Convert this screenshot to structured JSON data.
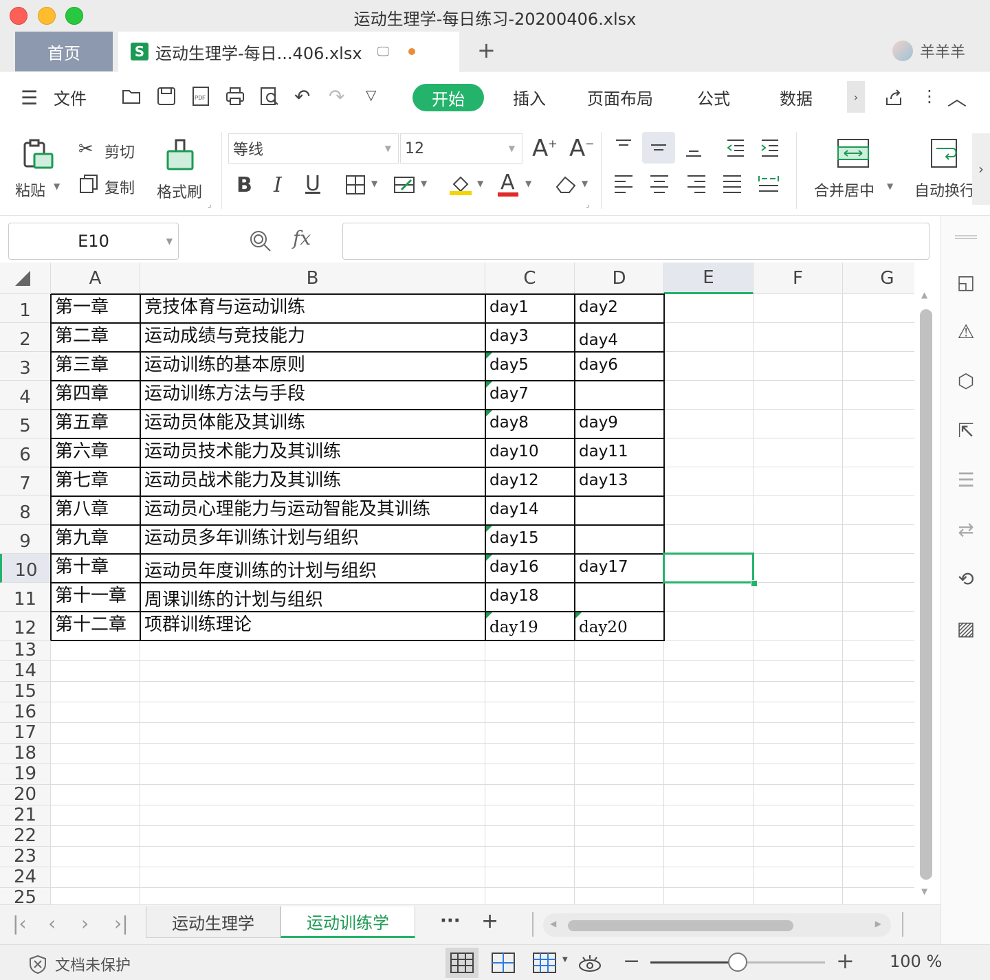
{
  "window": {
    "title": "运动生理学-每日练习-20200406.xlsx"
  },
  "tabs": {
    "home": "首页",
    "file_tab": "运动生理学-每日...406.xlsx",
    "add": "+"
  },
  "user": {
    "name": "羊羊羊"
  },
  "menu": {
    "file": "文件",
    "items": [
      "开始",
      "插入",
      "页面布局",
      "公式",
      "数据"
    ]
  },
  "toolbar": {
    "paste": "粘贴",
    "cut": "剪切",
    "copy": "复制",
    "format_painter": "格式刷",
    "font_name": "等线",
    "font_size": "12",
    "merge_center": "合并居中",
    "wrap_text": "自动换行"
  },
  "formula_bar": {
    "name_box": "E10",
    "fx": "fx",
    "content": ""
  },
  "sheet": {
    "columns": [
      "A",
      "B",
      "C",
      "D",
      "E",
      "F",
      "G"
    ],
    "active_column": "E",
    "active_row": 10,
    "rows": [
      {
        "n": "1",
        "a": "第一章",
        "b": "竞技体育与运动训练",
        "c": "day1",
        "d": "day2"
      },
      {
        "n": "2",
        "a": "第二章",
        "b": "运动成绩与竞技能力",
        "c": "day3",
        "d": "day4"
      },
      {
        "n": "3",
        "a": "第三章",
        "b": "运动训练的基本原则",
        "c": "day5",
        "d": "day6"
      },
      {
        "n": "4",
        "a": "第四章",
        "b": "运动训练方法与手段",
        "c": "day7",
        "d": ""
      },
      {
        "n": "5",
        "a": "第五章",
        "b": "运动员体能及其训练",
        "c": "day8",
        "d": "day9"
      },
      {
        "n": "6",
        "a": "第六章",
        "b": "运动员技术能力及其训练",
        "c": "day10",
        "d": "day11"
      },
      {
        "n": "7",
        "a": "第七章",
        "b": "运动员战术能力及其训练",
        "c": "day12",
        "d": "day13"
      },
      {
        "n": "8",
        "a": "第八章",
        "b": "运动员心理能力与运动智能及其训练",
        "c": "day14",
        "d": ""
      },
      {
        "n": "9",
        "a": "第九章",
        "b": "运动员多年训练计划与组织",
        "c": "day15",
        "d": ""
      },
      {
        "n": "10",
        "a": "第十章",
        "b": "运动员年度训练的计划与组织",
        "c": "day16",
        "d": "day17"
      },
      {
        "n": "11",
        "a": "第十一章",
        "b": "周课训练的计划与组织",
        "c": "day18",
        "d": ""
      },
      {
        "n": "12",
        "a": "第十二章",
        "b": "项群训练理论",
        "c": "day19",
        "d": "day20"
      }
    ],
    "empty_rows": [
      "13",
      "14",
      "15",
      "16",
      "17",
      "18",
      "19",
      "20",
      "21",
      "22",
      "23",
      "24",
      "25"
    ]
  },
  "sheet_tabs": [
    "运动生理学",
    "运动训练学"
  ],
  "active_sheet": "运动训练学",
  "status": {
    "protect": "文档未保护",
    "zoom": "100 %",
    "zoom_percent": 50
  },
  "colors": {
    "accent": "#24b36b",
    "tab_home": "#8d99ae"
  }
}
